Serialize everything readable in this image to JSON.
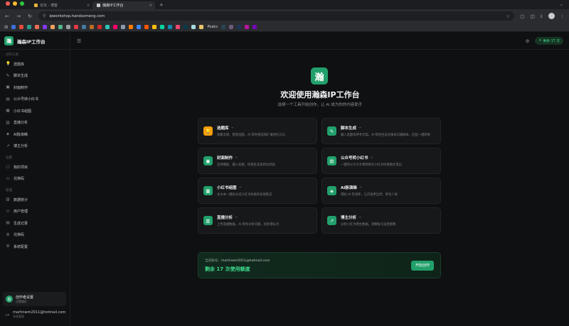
{
  "colors": {
    "brand": "#22a06b",
    "accent_text": "#3ddc8c",
    "background": "#0f1011"
  },
  "browser": {
    "tabs": [
      {
        "label": "论坛 - 博客",
        "fav": "#e8b23a",
        "close": "×"
      },
      {
        "label": "瀚森IP工作台",
        "fav": "#c9cbd0",
        "close": "×",
        "active": true
      }
    ],
    "new_tab": "+",
    "window_control": "⌄",
    "url": "ipworkshop.handsomeng.com",
    "bookmarks": [
      {
        "color": "#3b6fd8"
      },
      {
        "color": "#e14a3b"
      },
      {
        "color": "#2a9d8f"
      },
      {
        "color": "#e76f51"
      },
      {
        "color": "#8338ec"
      },
      {
        "color": "#f4a261"
      },
      {
        "color": "#52b788"
      },
      {
        "color": "#9a9ca0"
      },
      {
        "color": "#e63946"
      },
      {
        "color": "#457b9d"
      },
      {
        "color": "#bc6c25"
      },
      {
        "color": "#d62828"
      },
      {
        "color": "#2ec4b6"
      },
      {
        "color": "#ff006e"
      },
      {
        "color": "#8d99ae"
      },
      {
        "color": "#ff7b00"
      },
      {
        "color": "#3a86ff"
      },
      {
        "color": "#fb5607"
      },
      {
        "color": "#ffbe0b"
      },
      {
        "color": "#06d6a0"
      },
      {
        "color": "#118ab2"
      },
      {
        "color": "#ef476f"
      },
      {
        "color": "#073b4c"
      },
      {
        "color": "#a8dadc"
      },
      {
        "color": "#e9c46a"
      },
      {
        "color": "#264653"
      },
      {
        "color": "#6d597a"
      },
      {
        "color": "#1d3557"
      },
      {
        "color": "#b5179e"
      },
      {
        "color": "#7209b7"
      }
    ],
    "bookmark_label": "Peaks"
  },
  "app": {
    "brand_initial": "瀚",
    "brand_title": "瀚森IP工作台",
    "sidebar": {
      "sections": [
        {
          "title": "创作工具",
          "items": [
            {
              "label": "选题库",
              "icon": "bulb-icon",
              "glyph": "💡"
            },
            {
              "label": "脚本生成",
              "icon": "pen-icon",
              "glyph": "✎"
            },
            {
              "label": "封面制作",
              "icon": "image-icon",
              "glyph": "▣"
            },
            {
              "label": "公众号转小红书",
              "icon": "doc-icon",
              "glyph": "▤"
            },
            {
              "label": "小红书组图",
              "icon": "gallery-icon",
              "glyph": "▦"
            },
            {
              "label": "直播分析",
              "icon": "chart-icon",
              "glyph": "▥"
            },
            {
              "label": "AI脉演睇",
              "icon": "eraser-icon",
              "glyph": "◈"
            },
            {
              "label": "博主分析",
              "icon": "trend-icon",
              "glyph": "↗"
            }
          ]
        },
        {
          "title": "设置",
          "items": [
            {
              "label": "我的项目",
              "icon": "folder-icon",
              "glyph": "▢"
            },
            {
              "label": "兑换码",
              "icon": "ticket-icon",
              "glyph": "▭"
            }
          ]
        },
        {
          "title": "管理",
          "items": [
            {
              "label": "数据统计",
              "icon": "stats-icon",
              "glyph": "▥"
            },
            {
              "label": "用户管理",
              "icon": "users-icon",
              "glyph": "⚇"
            },
            {
              "label": "生成记录",
              "icon": "log-icon",
              "glyph": "▤"
            },
            {
              "label": "兑换码",
              "icon": "ticket-icon",
              "glyph": "⚙"
            },
            {
              "label": "系统配置",
              "icon": "gear-icon",
              "glyph": "⚙"
            }
          ]
        }
      ],
      "creator": {
        "initial": "创",
        "name": "创作者设置",
        "sub": "设置偏好"
      },
      "account": {
        "email": "martinwm2011@hotmail.com",
        "role": "系统管理"
      }
    },
    "topbar": {
      "quota": "剩余 17 次"
    },
    "hero": {
      "initial": "瀚",
      "title": "欢迎使用瀚森IP工作台",
      "subtitle": "选择一个工具开始创作，让 AI 成为你的内容助手"
    },
    "tools": [
      {
        "title": "选题库",
        "desc": "收集灵感、管理选题，AI 帮你筛选和扩展创作方向",
        "color": "#f59e0b",
        "glyph": "💡",
        "icon": "bulb-icon"
      },
      {
        "title": "脚本生成",
        "desc": "输入选题或参考文案，AI 帮你生成多版本口播脚本，匹配一键转换",
        "color": "#22a06b",
        "glyph": "✎",
        "icon": "pen-icon"
      },
      {
        "title": "封面制作",
        "desc": "选择模板、输入标题，快速生成高转化封面",
        "color": "#22a06b",
        "glyph": "▣",
        "icon": "image-icon"
      },
      {
        "title": "公众号转小红书",
        "desc": "一键将公众号文章转换为小红书风格图文笔记",
        "color": "#22a06b",
        "glyph": "▤",
        "icon": "doc-icon"
      },
      {
        "title": "小红书组图",
        "desc": "长文本一键拆分成小红书风格的多图笔记",
        "color": "#22a06b",
        "glyph": "▦",
        "icon": "gallery-icon"
      },
      {
        "title": "AI脉演睇",
        "desc": "借助 AI 检测率，让内容更自然、更有人味",
        "color": "#22a06b",
        "glyph": "◈",
        "icon": "eraser-icon"
      },
      {
        "title": "直播分析",
        "desc": "上传直播数据，AI 帮你分析问题，找到增长点",
        "color": "#22a06b",
        "glyph": "▥",
        "icon": "chart-icon"
      },
      {
        "title": "博主分析",
        "desc": "分析小红书博主数据，洞察账号运营策略",
        "color": "#22a06b",
        "glyph": "↗",
        "icon": "trend-icon"
      }
    ],
    "banner": {
      "account_label": "当前账号：",
      "account_email": "martinwm2011@hotmail.com",
      "remaining": "剩余 17 次使用额度",
      "start": "开始创作"
    }
  }
}
